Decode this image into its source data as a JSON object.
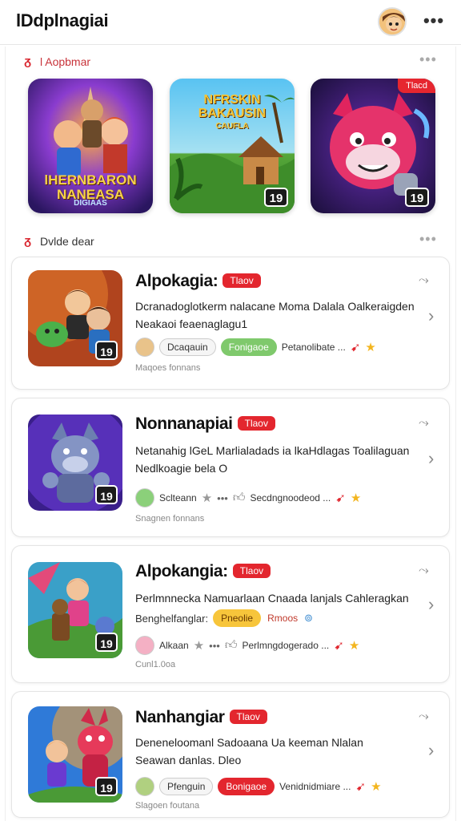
{
  "header": {
    "title": "lDdplnagiai",
    "more_label": "•••"
  },
  "featured": {
    "section_title": "l Aopbmar",
    "section_icon": "flame-icon",
    "more_label": "•••",
    "tiles": [
      {
        "caption": "lHERNBARON NANEASA",
        "subcaption": "DIGIAAS",
        "badge": "19"
      },
      {
        "caption": "NFRSKIN BAKAUSIN",
        "subcaption": "CAUFLA",
        "badge": "19"
      },
      {
        "corner": "Tlacd",
        "badge": "19"
      }
    ]
  },
  "list": {
    "section_title": "Dvlde dear",
    "section_icon": "flame-icon",
    "more_label": "•••",
    "cards": [
      {
        "title": "Alpokagia:",
        "tag": "Tlaov",
        "desc1": "Dcranadoglotkerm nalacane Moma Dalala Oalkeraigden",
        "desc2": "Neakaoi feaenaglagu1",
        "chips": [
          "Dcaqauin",
          "Fonigaoe",
          "Petanolibate ..."
        ],
        "footer": "Maqoes fonnans",
        "badge": "19"
      },
      {
        "title": "Nonnanapiai",
        "tag": "Tlaov",
        "desc1": "Netanahig lGeL Marlialadads ia lkaHdlagas Toalilaguan",
        "desc2": "Nedlkoagie bela O",
        "chips": [
          "Sclteann",
          "Secdngnoodeod ..."
        ],
        "footer": "Snagnen fonnans",
        "badge": "19"
      },
      {
        "title": "Alpokangia:",
        "tag": "Tlaov",
        "desc1": "Perlmnnecka Namuarlaan Cnaada lanjals Cahleragkan",
        "desc2": "Benghelfanglar:",
        "chips": [
          "Pneolie",
          "Rmoos",
          "Alkaan",
          "Perlmngdogerado ..."
        ],
        "footer": "Cunl1.0oa",
        "badge": "19"
      },
      {
        "title": "Nanhangiar",
        "tag": "Tlaov",
        "desc1": "Deneneloomanl Sadoaana Ua keeman Nlalan",
        "desc2": "Seawan danlas. Dleo",
        "chips": [
          "Pfenguin",
          "Bonigaoe",
          "Venidnidmiare ..."
        ],
        "footer": "Slagoen foutana",
        "badge": "19"
      }
    ]
  },
  "colors": {
    "accent_red": "#e3262e",
    "chip_green": "#7fc96c",
    "chip_yellow": "#f7c53b",
    "text_dark": "#111111"
  }
}
